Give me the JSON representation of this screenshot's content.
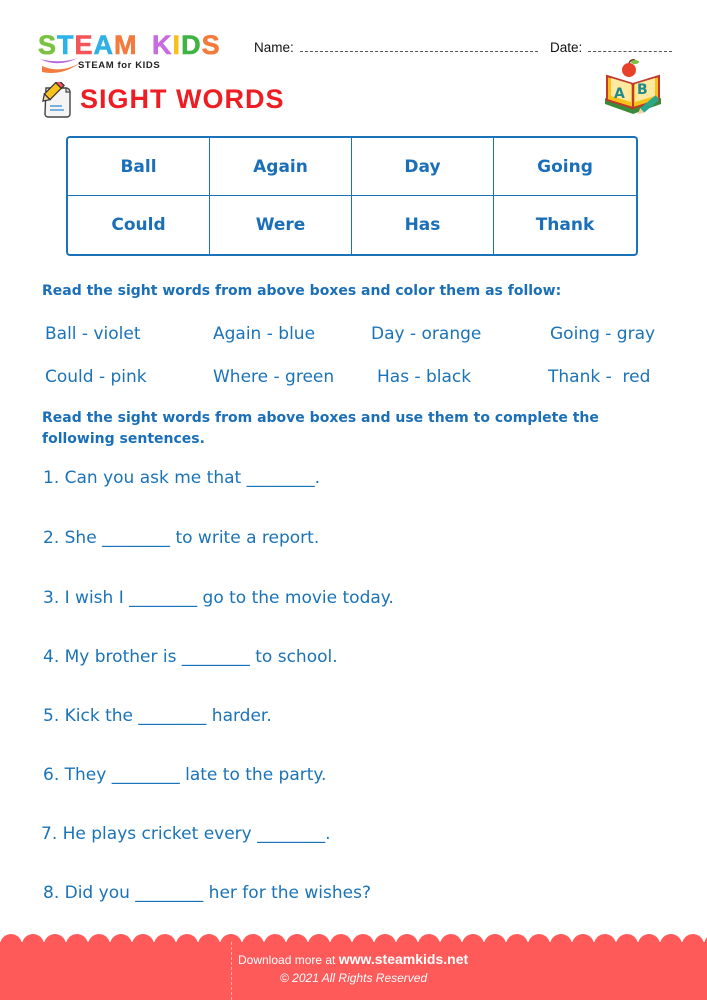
{
  "header": {
    "logo": {
      "letters": [
        {
          "char": "S",
          "color": "#7cc242"
        },
        {
          "char": "T",
          "color": "#2bb4e8"
        },
        {
          "char": "E",
          "color": "#f2555a"
        },
        {
          "char": "A",
          "color": "#2fb0e6"
        },
        {
          "char": "M",
          "color": "#f47b3e"
        },
        {
          "char": " ",
          "color": "#ffffff"
        },
        {
          "char": "K",
          "color": "#c86ae0"
        },
        {
          "char": "I",
          "color": "#f6c11a"
        },
        {
          "char": "D",
          "color": "#3fb444"
        },
        {
          "char": "S",
          "color": "#f47b3e"
        }
      ],
      "subtitle": "STEAM for KIDS"
    },
    "name_label": "Name:",
    "date_label": "Date:"
  },
  "title": {
    "text": "SIGHT WORDS",
    "icon": "pencil-paper-icon",
    "decoration_icon": "ab-book-apple-icon"
  },
  "word_table": {
    "rows": [
      [
        "Ball",
        "Again",
        "Day",
        "Going"
      ],
      [
        "Could",
        "Were",
        "Has",
        "Thank"
      ]
    ]
  },
  "instructions": {
    "color_task": "Read the sight words from above boxes and color them as follow:",
    "sentence_task": "Read the sight words from above boxes and use them to complete the following sentences."
  },
  "color_list": [
    [
      "Ball - violet",
      "Again - blue",
      "Day - orange",
      "Going - gray"
    ],
    [
      "Could - pink",
      "Where - green",
      "Has - black",
      "Thank -  red"
    ]
  ],
  "sentences": [
    "1. Can you ask me that ________.",
    "2. She ________ to write a report.",
    "3. I wish I ________ go to the movie today.",
    "4. My brother is ________ to school.",
    "5. Kick the ________ harder.",
    "6. They ________ late to the party.",
    "7. He plays cricket every ________.",
    "8. Did you ________ her for the wishes?"
  ],
  "footer": {
    "download_prefix": "Download more at",
    "site": "www.steamkids.net",
    "copyright": "©  2021 All Rights Reserved",
    "color": "#ff5a5a"
  }
}
